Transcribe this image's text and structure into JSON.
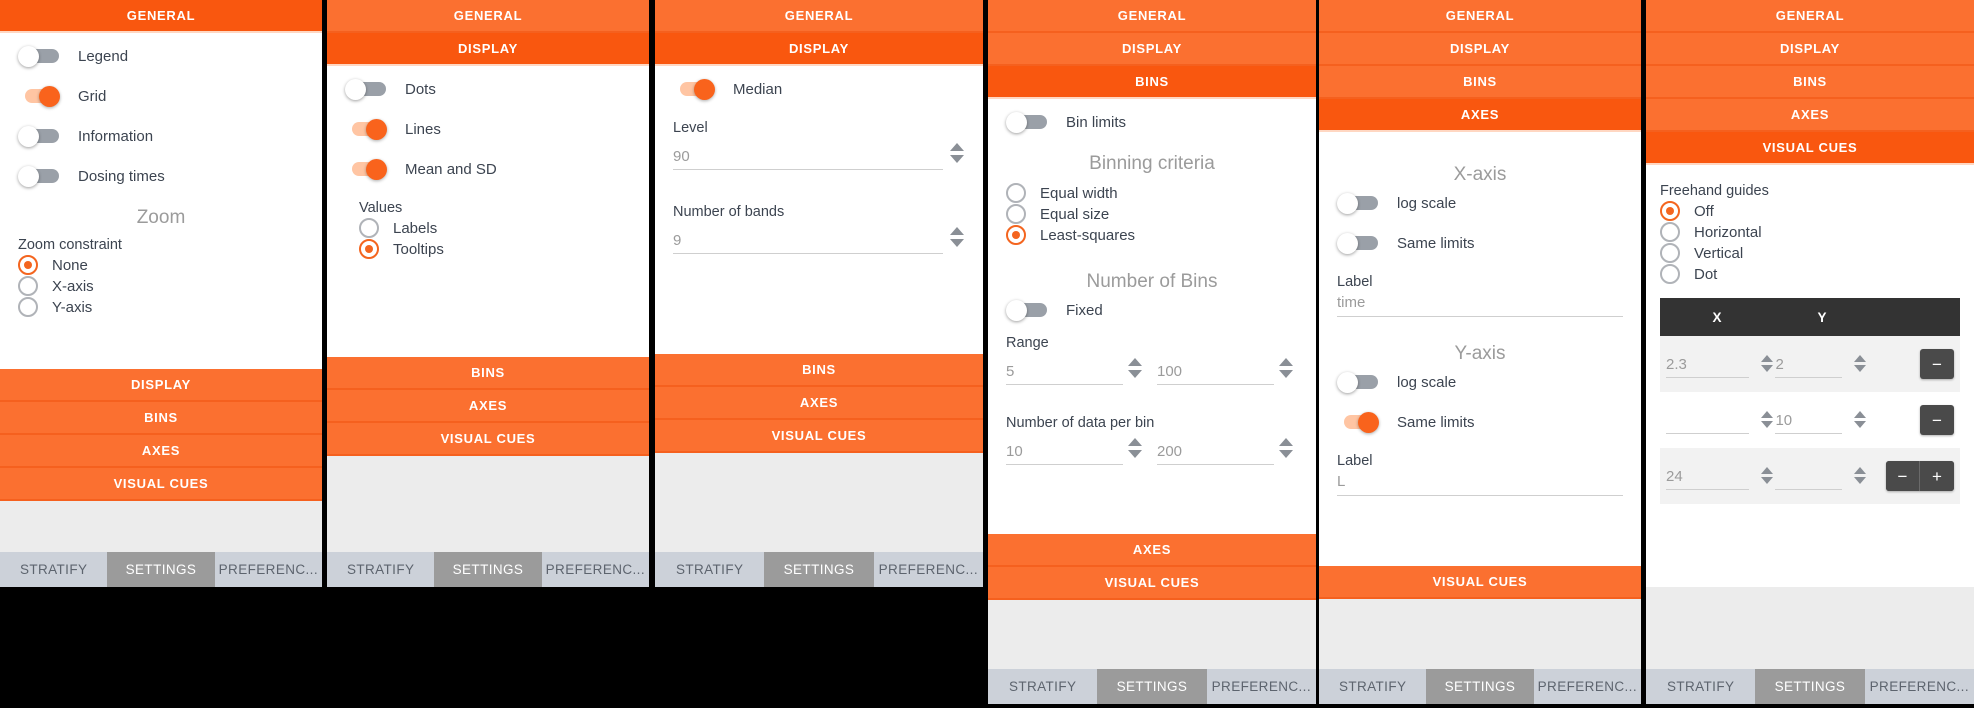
{
  "app": {
    "accent": "#f9570f",
    "accent_light": "#fb7030",
    "tab_active_bg": "#9b9b9b",
    "tab_bg": "#ccd1d9"
  },
  "sections": {
    "general": "GENERAL",
    "display": "DISPLAY",
    "bins": "BINS",
    "axes": "AXES",
    "visual_cues": "VISUAL CUES"
  },
  "tabs": [
    {
      "label": "STRATIFY",
      "active": false
    },
    {
      "label": "SETTINGS",
      "active": true
    },
    {
      "label": "PREFERENC...",
      "active": false
    }
  ],
  "panel_general": {
    "toggles": [
      {
        "label": "Legend",
        "on": false
      },
      {
        "label": "Grid",
        "on": true
      },
      {
        "label": "Information",
        "on": false
      },
      {
        "label": "Dosing times",
        "on": false
      }
    ],
    "zoom_caption": "Zoom",
    "zoom_constraint_label": "Zoom constraint",
    "zoom_constraint_options": [
      {
        "label": "None",
        "selected": true
      },
      {
        "label": "X-axis",
        "selected": false
      },
      {
        "label": "Y-axis",
        "selected": false
      }
    ]
  },
  "panel_display_scatter": {
    "toggles": [
      {
        "label": "Dots",
        "on": false
      },
      {
        "label": "Lines",
        "on": true
      },
      {
        "label": "Mean and SD",
        "on": true
      }
    ],
    "values_label": "Values",
    "values_options": [
      {
        "label": "Labels",
        "selected": false
      },
      {
        "label": "Tooltips",
        "selected": true
      }
    ]
  },
  "panel_display_median": {
    "toggles": [
      {
        "label": "Median",
        "on": true
      }
    ],
    "level_label": "Level",
    "level_value": "90",
    "bands_label": "Number of bands",
    "bands_value": "9"
  },
  "panel_bins": {
    "toggles": [
      {
        "label": "Bin limits",
        "on": false
      }
    ],
    "criteria_caption": "Binning criteria",
    "criteria_options": [
      {
        "label": "Equal width",
        "selected": false
      },
      {
        "label": "Equal size",
        "selected": false
      },
      {
        "label": "Least-squares",
        "selected": true
      }
    ],
    "number_caption": "Number of Bins",
    "fixed_label": "Fixed",
    "fixed_on": false,
    "range_label": "Range",
    "range_min": "5",
    "range_max": "100",
    "per_bin_label": "Number of data per bin",
    "per_bin_min": "10",
    "per_bin_max": "200"
  },
  "panel_axes": {
    "x_caption": "X-axis",
    "x_log_label": "log scale",
    "x_log_on": false,
    "x_same_label": "Same limits",
    "x_same_on": false,
    "x_label_label": "Label",
    "x_label_value": "time",
    "y_caption": "Y-axis",
    "y_log_label": "log scale",
    "y_log_on": false,
    "y_same_label": "Same limits",
    "y_same_on": true,
    "y_label_label": "Label",
    "y_label_value": "L"
  },
  "panel_visual_cues": {
    "freehand_label": "Freehand guides",
    "freehand_options": [
      {
        "label": "Off",
        "selected": true
      },
      {
        "label": "Horizontal",
        "selected": false
      },
      {
        "label": "Vertical",
        "selected": false
      },
      {
        "label": "Dot",
        "selected": false
      }
    ],
    "table": {
      "columns": [
        "X",
        "Y"
      ],
      "rows": [
        {
          "x": "2.3",
          "y": "2",
          "action": "minus"
        },
        {
          "x": "",
          "y": "10",
          "action": "minus"
        },
        {
          "x": "24",
          "y": "",
          "action": "minus-plus"
        }
      ],
      "minus_glyph": "−",
      "plus_glyph": "+"
    }
  }
}
